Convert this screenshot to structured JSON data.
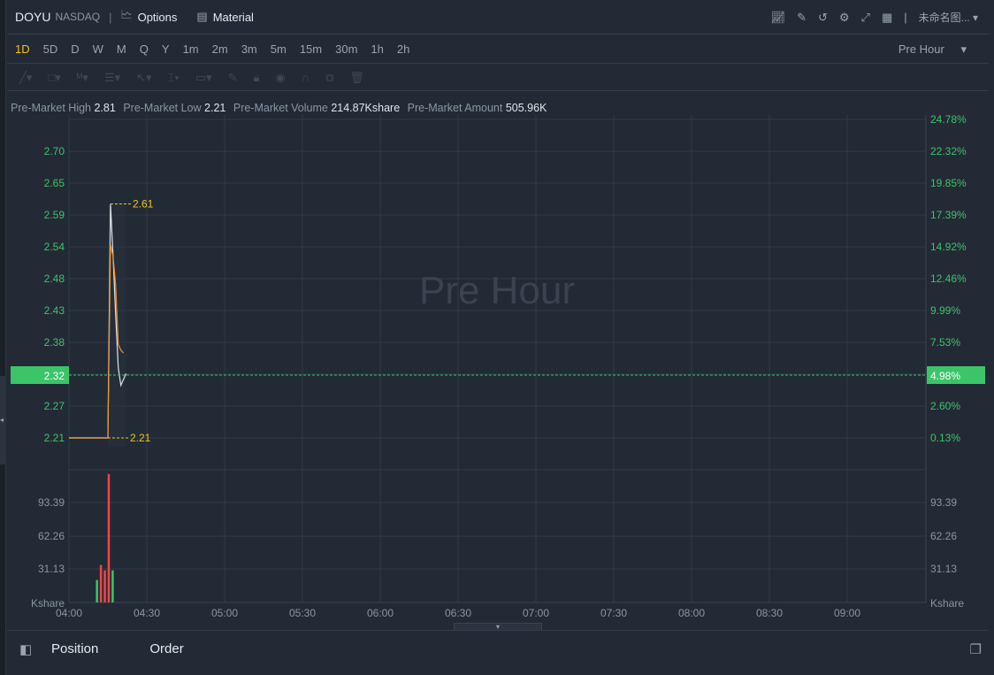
{
  "header": {
    "symbol": "DOYU",
    "exchange": "NASDAQ",
    "options_label": "Options",
    "material_label": "Material",
    "layout_name": "未命名图..."
  },
  "intervals": [
    "1D",
    "5D",
    "D",
    "W",
    "M",
    "Q",
    "Y",
    "1m",
    "2m",
    "3m",
    "5m",
    "15m",
    "30m",
    "1h",
    "2h"
  ],
  "active_interval": "1D",
  "session_select": "Pre Hour",
  "info": {
    "high_label": "Pre-Market High",
    "high": "2.81",
    "low_label": "Pre-Market Low",
    "low": "2.21",
    "volume_label": "Pre-Market Volume",
    "volume": "214.87Kshare",
    "amount_label": "Pre-Market Amount",
    "amount": "505.96K"
  },
  "watermark": "Pre Hour",
  "chart_data": {
    "type": "line",
    "price_ticks": [
      "2.70",
      "2.65",
      "2.59",
      "2.54",
      "2.48",
      "2.43",
      "2.38",
      "2.32",
      "2.27",
      "2.21"
    ],
    "pct_ticks": [
      "24.78%",
      "22.32%",
      "19.85%",
      "17.39%",
      "14.92%",
      "12.46%",
      "9.99%",
      "7.53%",
      "4.98%",
      "2.60%",
      "0.13%"
    ],
    "current_price": "2.32",
    "current_pct": "4.98%",
    "high_marker": "2.61",
    "low_marker": "2.21",
    "volume_ticks": [
      "93.39",
      "62.26",
      "31.13"
    ],
    "volume_unit": "Kshare",
    "time_ticks": [
      "04:00",
      "04:30",
      "05:00",
      "05:30",
      "06:00",
      "06:30",
      "07:00",
      "07:30",
      "08:00",
      "08:30",
      "09:00"
    ],
    "price_series": {
      "minutes": [
        0,
        15,
        16,
        17,
        18,
        19,
        20,
        21,
        22
      ],
      "values": [
        2.21,
        2.21,
        2.61,
        2.52,
        2.42,
        2.33,
        2.3,
        2.31,
        2.32
      ]
    },
    "avg_series": {
      "minutes": [
        15,
        16,
        17,
        18,
        19,
        20,
        21
      ],
      "values": [
        2.21,
        2.54,
        2.52,
        2.47,
        2.37,
        2.36,
        2.355
      ]
    },
    "volume_bars": [
      {
        "minute": 16,
        "value": 21,
        "color": "#3cc468"
      },
      {
        "minute": 17,
        "value": 35,
        "color": "#f04646"
      },
      {
        "minute": 18,
        "value": 30,
        "color": "#f04646"
      },
      {
        "minute": 19,
        "value": 120,
        "color": "#f04646"
      },
      {
        "minute": 20,
        "value": 30,
        "color": "#3cc468"
      }
    ]
  },
  "bottom": {
    "position_label": "Position",
    "order_label": "Order"
  }
}
